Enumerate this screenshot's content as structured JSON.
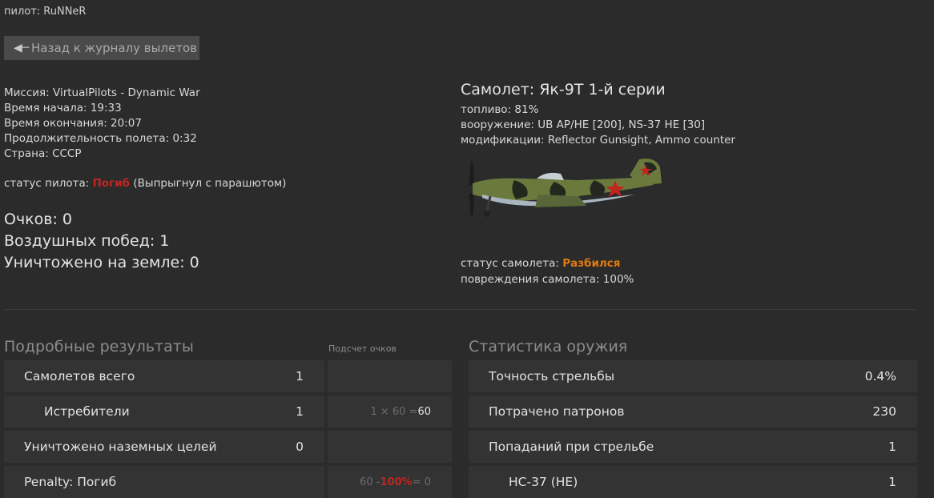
{
  "pilot": "пилот: RuNNeR",
  "back_button": "Назад к журналу вылетов",
  "mission": {
    "mission": "Миссия: VirtualPilots - Dynamic War",
    "start": "Время начала: 19:33",
    "end": "Время окончания: 20:07",
    "duration": "Продолжительность полета: 0:32",
    "country": "Страна: СССР"
  },
  "pilot_status": {
    "label": "статус пилота: ",
    "value": "Погиб",
    "note": " (Выпрыгнул с парашютом)"
  },
  "scores": {
    "points_label": "Очков: ",
    "points": "0",
    "air_label": "Воздушных побед: ",
    "air": "1",
    "ground_label": "Уничтожено на земле: ",
    "ground": "0"
  },
  "plane": {
    "title": "Самолет: Як-9Т 1-й серии",
    "fuel": "топливо: 81%",
    "armament": "вооружение: UB AP/HE [200], NS-37 HE [30]",
    "mods": "модификации: Reflector Gunsight, Ammo counter",
    "status_label": "статус самолета: ",
    "status_value": "Разбился",
    "damage": "повреждения самолета: 100%"
  },
  "results": {
    "title": "Подробные результаты",
    "score_header": "Подсчет очков",
    "rows": [
      {
        "label": "Самолетов всего",
        "value": "1",
        "calc_pre": "",
        "calc_hl": "",
        "calc_post": "",
        "calc_result": ""
      },
      {
        "label": "Истребители",
        "value": "1",
        "calc_pre": "1 × 60 = ",
        "calc_hl": "",
        "calc_post": "",
        "calc_result": "60"
      },
      {
        "label": "Уничтожено наземных целей",
        "value": "0",
        "calc_pre": "",
        "calc_hl": "",
        "calc_post": "",
        "calc_result": ""
      },
      {
        "label": "Penalty: Погиб",
        "value": "",
        "calc_pre": "60 - ",
        "calc_hl": "100%",
        "calc_post": " = 0",
        "calc_result": ""
      }
    ]
  },
  "weapons": {
    "title": "Статистика оружия",
    "rows": [
      {
        "label": "Точность стрельбы",
        "value": "0.4%"
      },
      {
        "label": "Потрачено патронов",
        "value": "230"
      },
      {
        "label": "Попаданий при стрельбе",
        "value": "1"
      },
      {
        "label": "НС-37 (HE)",
        "value": "1"
      }
    ]
  },
  "colors": {
    "background": "#2b2b2b",
    "row_bg": "#333333",
    "danger": "#c0261f",
    "warning": "#e07a10"
  }
}
